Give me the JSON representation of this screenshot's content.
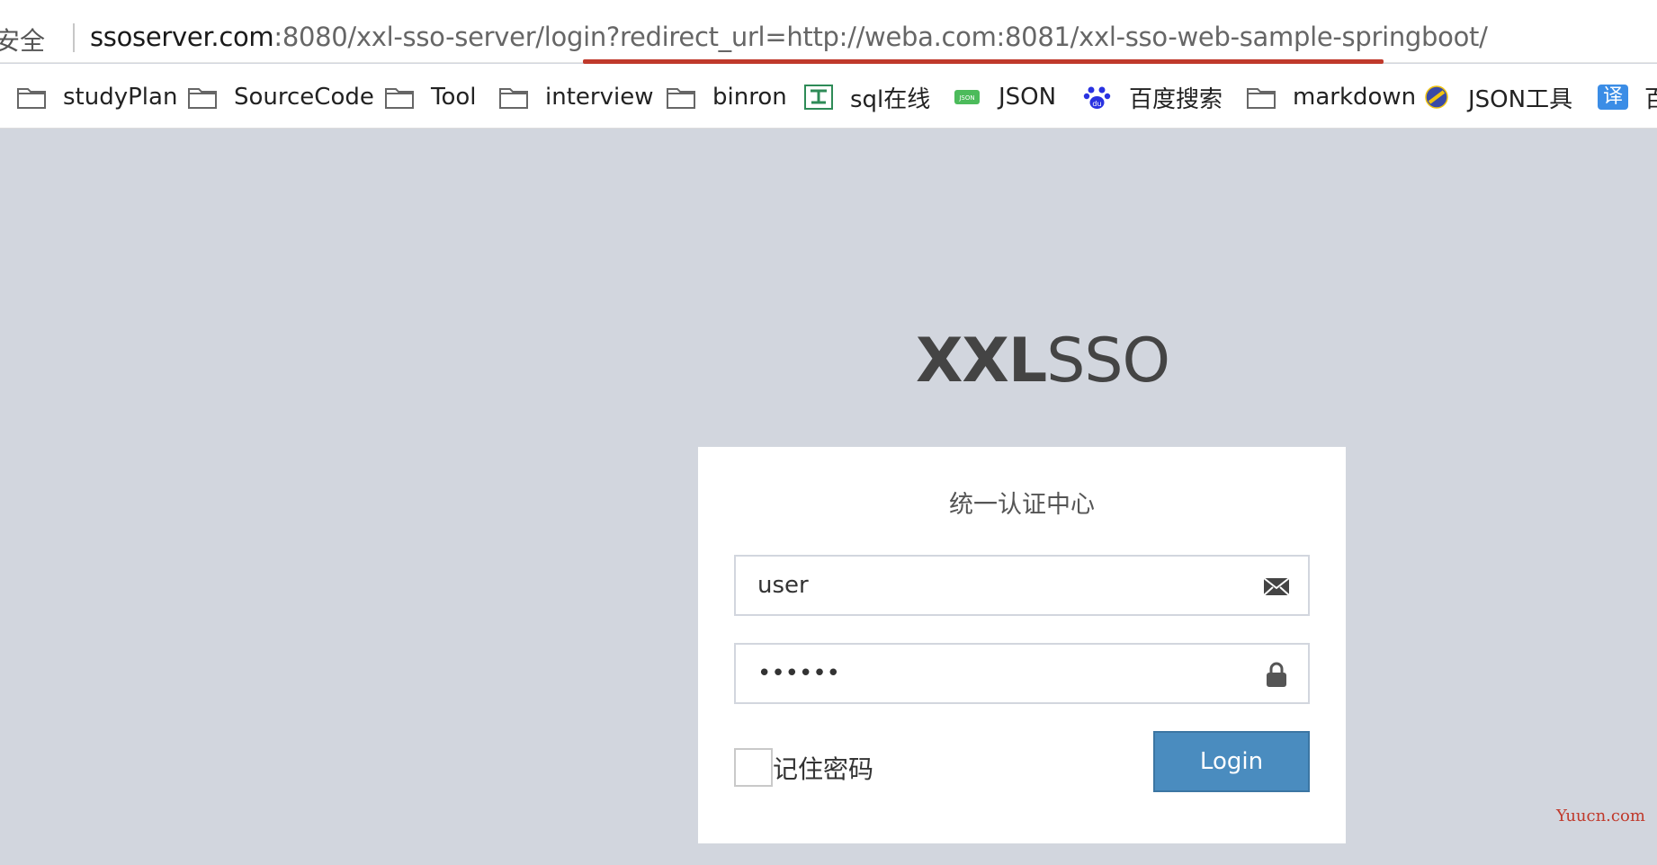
{
  "address_bar": {
    "security_text": "不安全",
    "url_host": "ssoserver.com",
    "url_rest": ":8080/xxl-sso-server/login?redirect_url=http://weba.com:8081/xxl-sso-web-sample-springboot/",
    "highlight_color": "#c0392b"
  },
  "bookmarks": [
    {
      "label": "studyPlan",
      "icon": "folder-icon"
    },
    {
      "label": "SourceCode",
      "icon": "folder-icon"
    },
    {
      "label": "Tool",
      "icon": "folder-icon"
    },
    {
      "label": "interview",
      "icon": "folder-icon"
    },
    {
      "label": "binron",
      "icon": "folder-icon"
    },
    {
      "label": "sql在线",
      "icon": "sql-tool-icon"
    },
    {
      "label": "JSON",
      "icon": "json-icon"
    },
    {
      "label": "百度搜索",
      "icon": "baidu-paw-icon"
    },
    {
      "label": "markdown",
      "icon": "folder-icon"
    },
    {
      "label": "JSON工具",
      "icon": "json-tool-icon"
    },
    {
      "label": "百",
      "icon": "translate-icon",
      "icon_text": "译"
    }
  ],
  "logo": {
    "bold": "XXL",
    "light": "SSO"
  },
  "login": {
    "title": "统一认证中心",
    "username_value": "user",
    "password_value": "123456",
    "remember_label": "记住密码",
    "login_button": "Login",
    "button_color": "#4a8cbf"
  },
  "watermark": "Yuucn.com",
  "colors": {
    "page_background": "#d2d6de"
  }
}
